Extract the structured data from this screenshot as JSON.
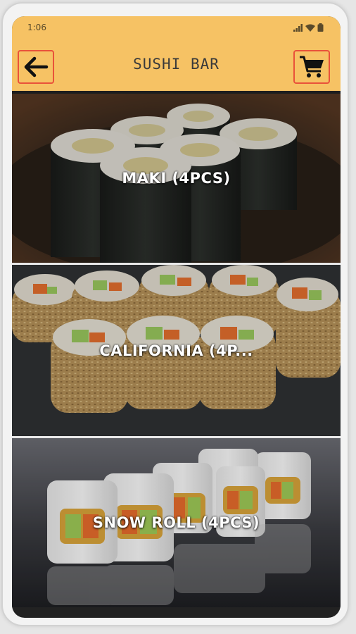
{
  "status_bar": {
    "time": "1:06",
    "icons": [
      "signal-icon",
      "wifi-icon",
      "battery-icon"
    ]
  },
  "app_bar": {
    "title": "SUSHI BAR",
    "back_icon": "arrow-left-icon",
    "cart_icon": "shopping-cart-icon",
    "accent_color": "#f6c264",
    "border_color": "#e9523a"
  },
  "menu": {
    "items": [
      {
        "label": "MAKI (4PCS)",
        "image": "maki-photo"
      },
      {
        "label": "CALIFORNIA (4P...",
        "image": "california-roll-photo"
      },
      {
        "label": "SNOW ROLL (4PCS)",
        "image": "snow-roll-photo"
      }
    ]
  }
}
